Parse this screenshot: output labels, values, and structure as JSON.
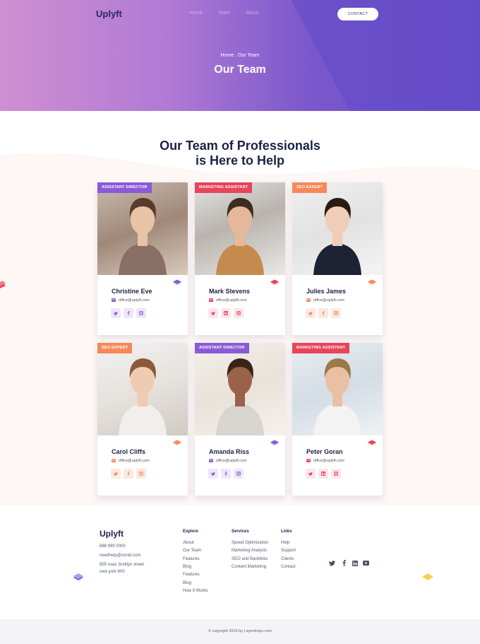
{
  "header": {
    "logo": "Uplyft",
    "nav": [
      "Home",
      "Team",
      "About"
    ],
    "contact_label": "CONTACT"
  },
  "hero": {
    "breadcrumb": "Home . Our Team",
    "title": "Our Team"
  },
  "section": {
    "title_line1": "Our Team of Professionals",
    "title_line2": "is Here to Help"
  },
  "colors": {
    "purple": "#8a5ad8",
    "red": "#e8445a",
    "orange": "#f7885a",
    "purple_bg": "#efe6fb",
    "red_bg": "#fde5ea",
    "orange_bg": "#fde9df"
  },
  "team": [
    {
      "role": "ASSISTANT DIRECTOR",
      "name": "Christine Eve",
      "email": "office@uplyft.com",
      "accent": "purple",
      "socials": [
        "twitter-icon",
        "facebook-icon",
        "instagram-icon"
      ]
    },
    {
      "role": "MARKETING ASSISTANT",
      "name": "Mark Stevens",
      "email": "office@uplyft.com",
      "accent": "red",
      "socials": [
        "twitter-icon",
        "linkedin-icon",
        "instagram-icon"
      ]
    },
    {
      "role": "SEO EXPERT",
      "name": "Julies James",
      "email": "office@uplyft.com",
      "accent": "orange",
      "socials": [
        "twitter-icon",
        "facebook-icon",
        "instagram-icon"
      ]
    },
    {
      "role": "SEO EXPERT",
      "name": "Carol Cliffs",
      "email": "office@uplyft.com",
      "accent": "orange",
      "socials": [
        "twitter-icon",
        "facebook-icon",
        "instagram-icon"
      ]
    },
    {
      "role": "ASSISTANT DIRECTOR",
      "name": "Amanda Riss",
      "email": "office@uplyft.com",
      "accent": "purple",
      "socials": [
        "twitter-icon",
        "facebook-icon",
        "instagram-icon"
      ]
    },
    {
      "role": "MARKETING ASSISTANT",
      "name": "Peter Goran",
      "email": "office@uplyft.com",
      "accent": "red",
      "socials": [
        "twitter-icon",
        "linkedin-icon",
        "instagram-icon"
      ]
    }
  ],
  "footer": {
    "logo": "Uplyft",
    "phone": "888 999 0000",
    "email": "needhelp@nonid.com",
    "address1": "855 road, broklyn street",
    "address2": "new york 600",
    "explore": {
      "title": "Explore",
      "links": [
        "About",
        "Our Team",
        "Features",
        "Blog",
        "Features",
        "Blog",
        "How It Works"
      ]
    },
    "services": {
      "title": "Services",
      "links": [
        "Speed Optimization",
        "Marketing Analysis",
        "SEO and Backlinks",
        "Content Marketing"
      ]
    },
    "links": {
      "title": "Links",
      "links": [
        "Help",
        "Support",
        "Clients",
        "Contact"
      ]
    },
    "socials": [
      "twitter-icon",
      "facebook-icon",
      "linkedin-icon",
      "youtube-icon"
    ],
    "copyright": "© copyright 2019 by Layerdrops.com"
  }
}
